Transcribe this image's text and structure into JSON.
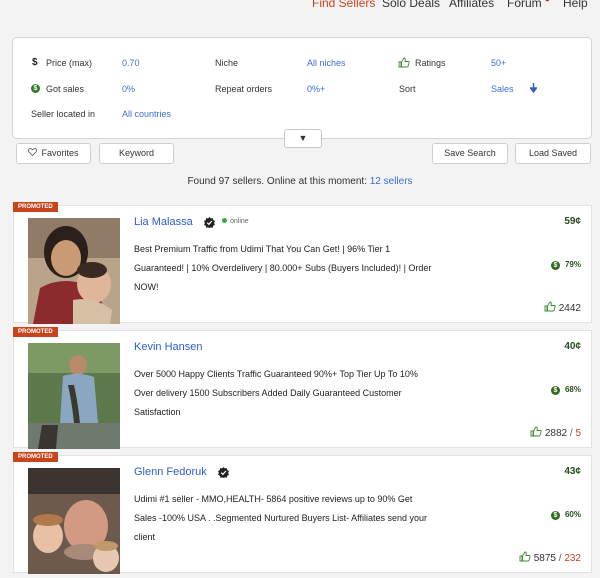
{
  "nav": {
    "find_sellers": "Find Sellers",
    "solo_deals": "Solo Deals",
    "affiliates": "Affiliates",
    "forum": "Forum",
    "forum_dot": "●",
    "help": "Help"
  },
  "filters": {
    "price_label": "Price (max)",
    "price_value": "0.70",
    "niche_label": "Niche",
    "niche_value": "All niches",
    "ratings_label": "Ratings",
    "ratings_value": "50+",
    "got_sales_label": "Got sales",
    "got_sales_value": "0%",
    "repeat_label": "Repeat orders",
    "repeat_value": "0%+",
    "sort_label": "Sort",
    "sort_value": "Sales",
    "location_label": "Seller located in",
    "location_value": "All countries",
    "expand_symbol": "▼"
  },
  "actions": {
    "favorites": "Favorites",
    "keyword": "Keyword",
    "save_search": "Save Search",
    "load_saved": "Load Saved"
  },
  "summary": {
    "text": "Found 97 sellers. Online at this moment:",
    "online_link": "12 sellers"
  },
  "colors": {
    "accent_orange": "#c8441c",
    "link_blue": "#3b6fd0",
    "money_green": "#2b4d1f"
  },
  "sellers": [
    {
      "promo": "PROMOTED",
      "name": "Lia Malassa",
      "status": "online",
      "description": "Best Premium Traffic from Udimi That You Can Get! | 96% Tier 1 Guaranteed! | 10% Overdelivery | 80.000+ Subs (Buyers Included)! | Order NOW!",
      "price": "59¢",
      "sales_pct": "79%",
      "likes": "2442",
      "dislikes": ""
    },
    {
      "promo": "PROMOTED",
      "name": "Kevin Hansen",
      "status": "",
      "description": "Over 5000 Happy Clients Traffic Guaranteed 90%+ Top Tier Up To 10% Over delivery 1500 Subscribers Added Daily Guaranteed Customer Satisfaction",
      "price": "40¢",
      "sales_pct": "68%",
      "likes": "2882",
      "dislikes": "5"
    },
    {
      "promo": "PROMOTED",
      "name": "Glenn Fedoruk",
      "status": "",
      "description": "Udimi #1 seller - MMO,HEALTH- 5864 positive reviews up to 90% Get Sales -100% USA . .Segmented Nurtured Buyers List- Affiliates send your client",
      "price": "43¢",
      "sales_pct": "60%",
      "likes": "5875",
      "dislikes": "232"
    }
  ]
}
